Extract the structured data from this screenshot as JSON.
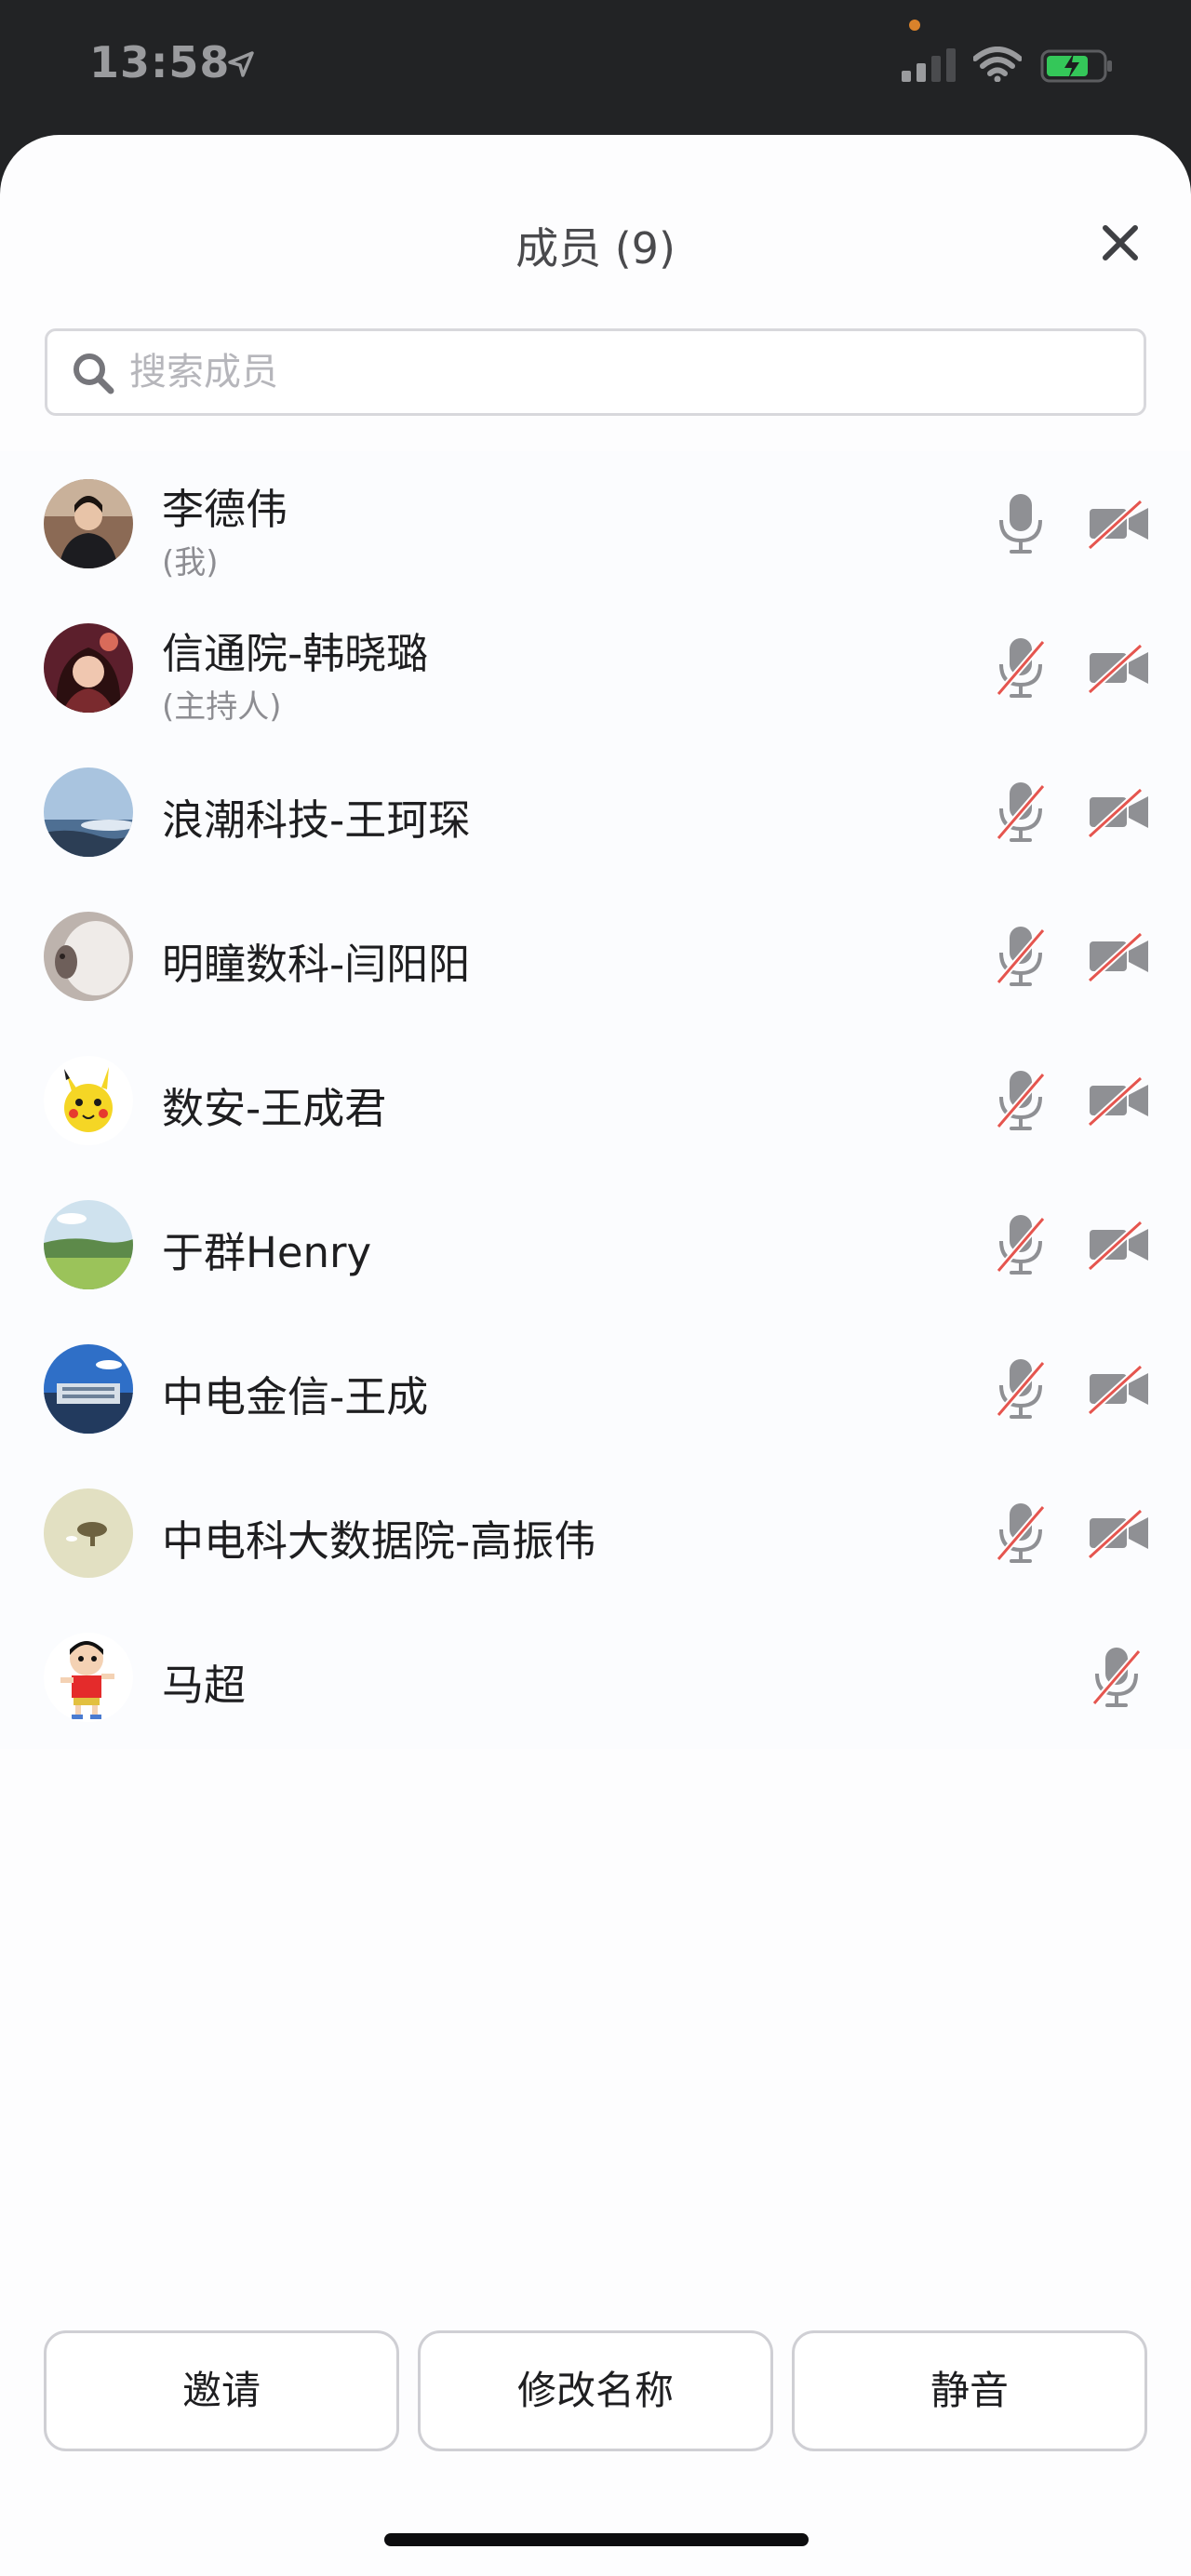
{
  "status_bar": {
    "time": "13:58",
    "icons": [
      "location-arrow-icon",
      "signal-icon",
      "wifi-icon",
      "battery-charging-icon"
    ],
    "colors": {
      "privacy_dot": "#d9822b",
      "battery": "#34c759"
    }
  },
  "sheet": {
    "title": "成员 (9)",
    "close_icon": "close-icon"
  },
  "search": {
    "placeholder": "搜索成员",
    "value": ""
  },
  "members": [
    {
      "name": "李德伟",
      "role": "(我)",
      "mic": "on",
      "camera": "off"
    },
    {
      "name": "信通院-韩晓璐",
      "role": "(主持人)",
      "mic": "off",
      "camera": "off"
    },
    {
      "name": "浪潮科技-王珂琛",
      "role": "",
      "mic": "off",
      "camera": "off"
    },
    {
      "name": "明瞳数科-闫阳阳",
      "role": "",
      "mic": "off",
      "camera": "off"
    },
    {
      "name": "数安-王成君",
      "role": "",
      "mic": "off",
      "camera": "off"
    },
    {
      "name": "于群Henry",
      "role": "",
      "mic": "off",
      "camera": "off"
    },
    {
      "name": "中电金信-王成",
      "role": "",
      "mic": "off",
      "camera": "off"
    },
    {
      "name": "中电科大数据院-高振伟",
      "role": "",
      "mic": "off",
      "camera": "off"
    },
    {
      "name": "马超",
      "role": "",
      "mic": "off",
      "camera": "none"
    }
  ],
  "actions": {
    "invite": "邀请",
    "rename": "修改名称",
    "mute": "静音"
  },
  "colors": {
    "muted_slash": "#e5554f",
    "icon_gray": "#8f9094",
    "text_primary": "#1e1e20"
  }
}
